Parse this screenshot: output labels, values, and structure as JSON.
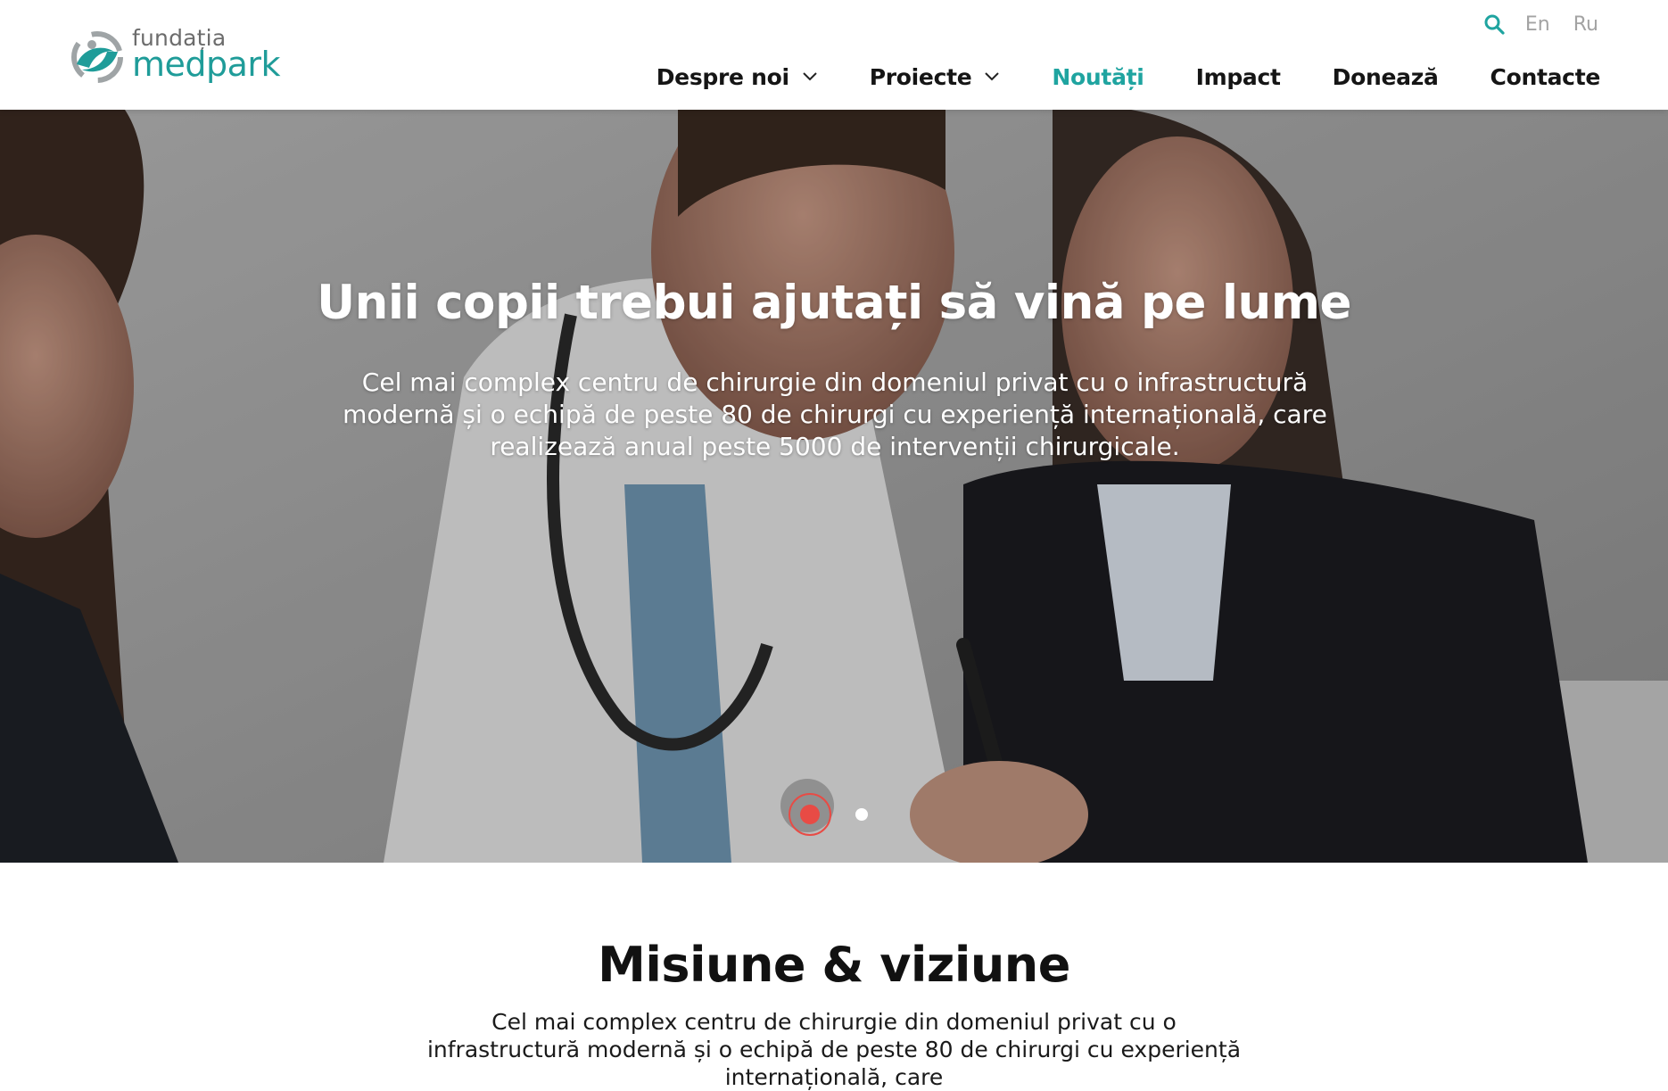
{
  "brand": {
    "small": "fundația",
    "name": "medpark",
    "color": "#1f9c99"
  },
  "header": {
    "search_icon": "search-icon",
    "languages": [
      "En",
      "Ru"
    ],
    "nav": [
      {
        "label": "Despre noi",
        "dropdown": true,
        "active": false
      },
      {
        "label": "Proiecte",
        "dropdown": true,
        "active": false
      },
      {
        "label": "Noutăți",
        "dropdown": false,
        "active": true
      },
      {
        "label": "Impact",
        "dropdown": false,
        "active": false
      },
      {
        "label": "Donează",
        "dropdown": false,
        "active": false
      },
      {
        "label": "Contacte",
        "dropdown": false,
        "active": false
      }
    ],
    "active_color": "#1fa4a0"
  },
  "hero": {
    "title": "Unii copii trebui ajutați să vină pe lume",
    "text": "Cel mai complex centru de chirurgie din domeniul privat cu o infrastructură modernă și o echipă de peste 80 de chirurgi cu experiență internațională, care realizează anual peste 5000 de intervenții chirurgicale.",
    "slides": 2,
    "active_slide": 1,
    "dot_color": "#e84b45"
  },
  "mission": {
    "title": "Misiune & viziune",
    "text": "Cel mai complex centru de chirurgie din domeniul privat cu o infrastructură modernă și o echipă de peste 80 de chirurgi cu experiență internațională, care"
  }
}
